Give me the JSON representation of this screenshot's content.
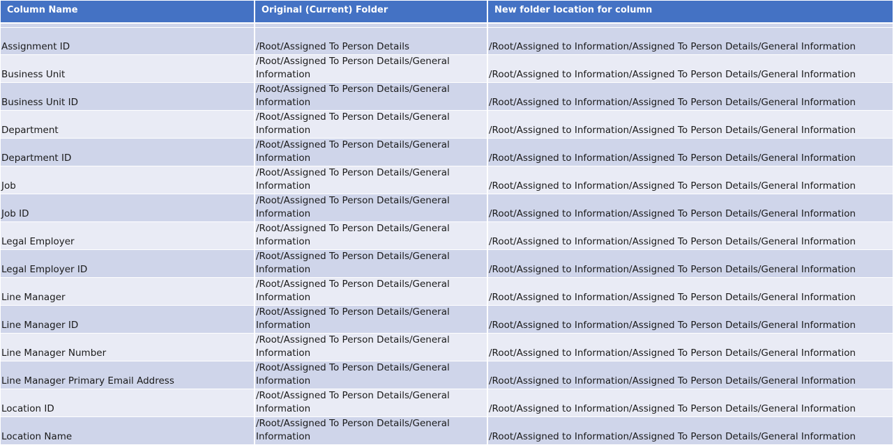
{
  "headers": {
    "column_name": "Column Name",
    "original_folder": "Original (Current) Folder",
    "new_folder": "New folder location for column"
  },
  "rows": [
    {
      "name": "Assignment ID",
      "original": "/Root/Assigned To Person Details",
      "new": "/Root/Assigned to Information/Assigned To Person Details/General Information"
    },
    {
      "name": "Business Unit",
      "original": "/Root/Assigned To Person Details/General Information",
      "new": "/Root/Assigned to Information/Assigned To Person Details/General Information"
    },
    {
      "name": "Business Unit ID",
      "original": "/Root/Assigned To Person Details/General Information",
      "new": "/Root/Assigned to Information/Assigned To Person Details/General Information"
    },
    {
      "name": "Department",
      "original": "/Root/Assigned To Person Details/General Information",
      "new": "/Root/Assigned to Information/Assigned To Person Details/General Information"
    },
    {
      "name": "Department  ID",
      "original": "/Root/Assigned To Person Details/General Information",
      "new": "/Root/Assigned to Information/Assigned To Person Details/General Information"
    },
    {
      "name": "Job",
      "original": "/Root/Assigned To Person Details/General Information",
      "new": "/Root/Assigned to Information/Assigned To Person Details/General Information"
    },
    {
      "name": "Job ID",
      "original": "/Root/Assigned To Person Details/General Information",
      "new": "/Root/Assigned to Information/Assigned To Person Details/General Information"
    },
    {
      "name": "Legal Employer",
      "original": "/Root/Assigned To Person Details/General Information",
      "new": "/Root/Assigned to Information/Assigned To Person Details/General Information"
    },
    {
      "name": "Legal Employer ID",
      "original": "/Root/Assigned To Person Details/General Information",
      "new": "/Root/Assigned to Information/Assigned To Person Details/General Information"
    },
    {
      "name": "Line Manager",
      "original": "/Root/Assigned To Person Details/General Information",
      "new": "/Root/Assigned to Information/Assigned To Person Details/General Information"
    },
    {
      "name": "Line Manager ID",
      "original": "/Root/Assigned To Person Details/General Information",
      "new": "/Root/Assigned to Information/Assigned To Person Details/General Information"
    },
    {
      "name": "Line Manager Number",
      "original": "/Root/Assigned To Person Details/General Information",
      "new": "/Root/Assigned to Information/Assigned To Person Details/General Information"
    },
    {
      "name": "Line Manager Primary  Email Address",
      "original": "/Root/Assigned To Person Details/General Information",
      "new": "/Root/Assigned to Information/Assigned To Person Details/General Information"
    },
    {
      "name": "Location ID",
      "original": "/Root/Assigned To Person Details/General Information",
      "new": "/Root/Assigned to Information/Assigned To Person Details/General Information"
    },
    {
      "name": "Location Name",
      "original": "/Root/Assigned To Person Details/General Information",
      "new": "/Root/Assigned to Information/Assigned To Person Details/General Information"
    }
  ]
}
